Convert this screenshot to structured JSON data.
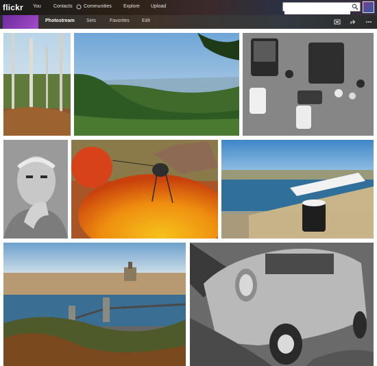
{
  "app": {
    "logo": "flickr"
  },
  "topnav": {
    "items": [
      {
        "label": "You"
      },
      {
        "label": "Contacts"
      },
      {
        "label": "Communities"
      },
      {
        "label": "Explore"
      },
      {
        "label": "Upload"
      }
    ]
  },
  "search": {
    "placeholder": "",
    "value": ""
  },
  "subnav": {
    "items": [
      {
        "label": "Photostream"
      },
      {
        "label": "Sets"
      },
      {
        "label": "Favorites"
      },
      {
        "label": "Edit"
      }
    ],
    "icons": [
      "slideshow-icon",
      "share-icon",
      "more-icon"
    ]
  },
  "colors": {
    "topbar": "#1a1a1a",
    "active_tab": "#ffffff",
    "tab": "#dddddd"
  }
}
